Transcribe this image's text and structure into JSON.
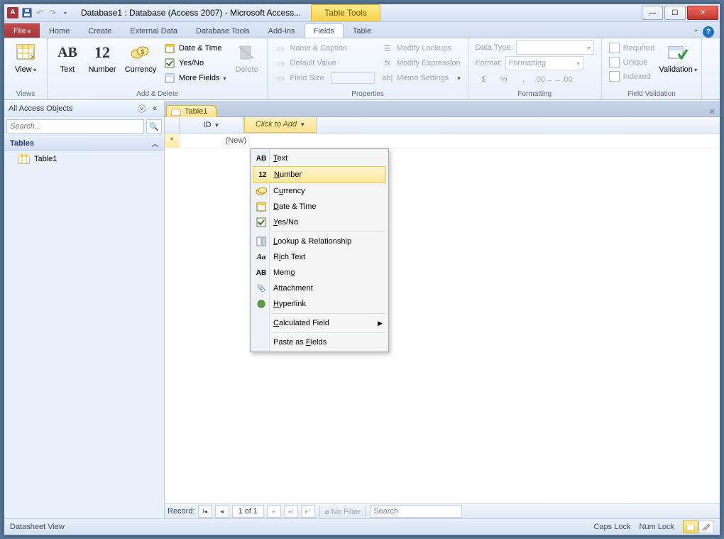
{
  "title": "Database1 : Database (Access 2007)  -  Microsoft Access...",
  "context_tab_cap": "Table Tools",
  "tabs": {
    "file": "File",
    "home": "Home",
    "create": "Create",
    "external": "External Data",
    "dbtools": "Database Tools",
    "addins": "Add-Ins",
    "fields": "Fields",
    "table": "Table"
  },
  "ribbon": {
    "views": {
      "view": "View",
      "group": "Views"
    },
    "add_delete": {
      "text": "Text",
      "number": "Number",
      "currency": "Currency",
      "datetime": "Date & Time",
      "yesno": "Yes/No",
      "more": "More Fields",
      "delete": "Delete",
      "group": "Add & Delete"
    },
    "properties": {
      "name_caption": "Name & Caption",
      "default_value": "Default Value",
      "field_size": "Field Size",
      "modify_lookups": "Modify Lookups",
      "modify_expression": "Modify Expression",
      "memo_settings": "Memo Settings",
      "group": "Properties"
    },
    "formatting": {
      "data_type_label": "Data Type:",
      "format_label": "Format:",
      "format_value": "Formatting",
      "currency_btn": "$",
      "percent_btn": "%",
      "comma_btn": ",",
      "group": "Formatting"
    },
    "validation": {
      "required": "Required",
      "unique": "Unique",
      "indexed": "Indexed",
      "validation": "Validation",
      "group": "Field Validation"
    }
  },
  "nav": {
    "header": "All Access Objects",
    "search_placeholder": "Search...",
    "group": "Tables",
    "items": [
      "Table1"
    ]
  },
  "document": {
    "tab": "Table1",
    "columns": {
      "id": "ID",
      "add": "Click to Add"
    },
    "new_row": "(New)"
  },
  "field_menu": {
    "text": "Text",
    "number": "Number",
    "currency": "Currency",
    "datetime": "Date & Time",
    "yesno": "Yes/No",
    "lookup": "Lookup & Relationship",
    "rich": "Rich Text",
    "memo": "Memo",
    "attachment": "Attachment",
    "hyperlink": "Hyperlink",
    "calculated": "Calculated Field",
    "paste": "Paste as Fields"
  },
  "record_nav": {
    "label": "Record:",
    "position": "1 of 1",
    "no_filter": "No Filter",
    "search": "Search"
  },
  "status": {
    "left": "Datasheet View",
    "caps": "Caps Lock",
    "num": "Num Lock"
  }
}
